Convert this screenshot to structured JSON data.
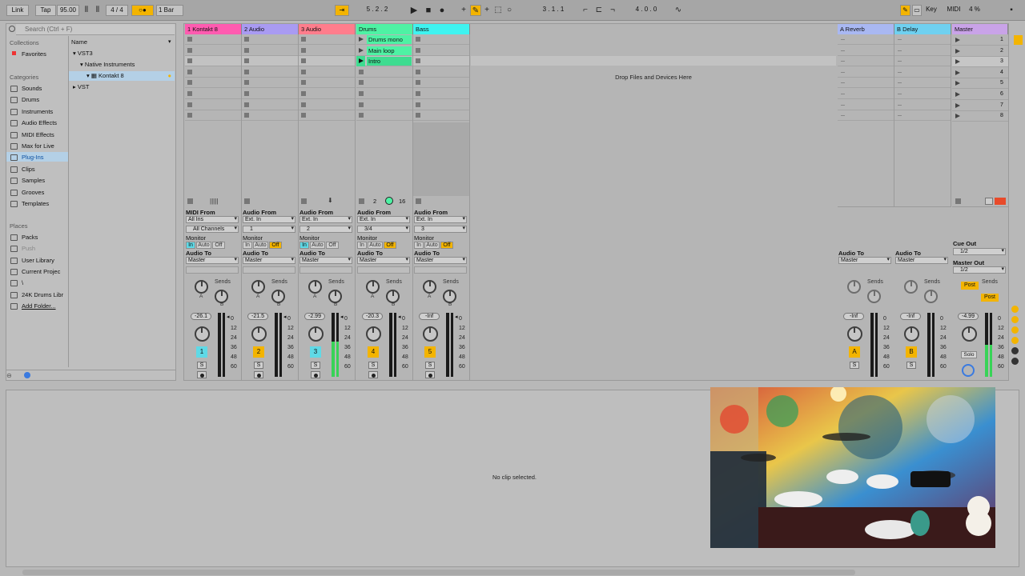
{
  "transport": {
    "link": "Link",
    "tap": "Tap",
    "tempo": "95.00",
    "signature": "4 / 4",
    "quantize": "1 Bar",
    "position": "5 .  2 .  2",
    "loop_start": "3 .  1 .  1",
    "loop_length": "4 .  0 .  0",
    "key": "Key",
    "midi": "MIDI",
    "cpu": "4 %"
  },
  "browser": {
    "search_placeholder": "Search (Ctrl + F)",
    "collections_header": "Collections",
    "favorites": "Favorites",
    "categories_header": "Categories",
    "categories": [
      "Sounds",
      "Drums",
      "Instruments",
      "Audio Effects",
      "MIDI Effects",
      "Max for Live",
      "Plug-Ins",
      "Clips",
      "Samples",
      "Grooves",
      "Templates"
    ],
    "places_header": "Places",
    "places": [
      "Packs",
      "Push",
      "User Library",
      "Current Projec",
      "\\",
      "24K Drums Libr",
      "Add Folder..."
    ],
    "name_header": "Name",
    "tree": {
      "vst3": "VST3",
      "native": "Native Instruments",
      "kontakt": "Kontakt 8",
      "vst": "VST"
    }
  },
  "tracks": [
    {
      "name": "1 Kontakt 8",
      "color": "#ff5bb0",
      "io_from": "MIDI From",
      "from": "All Ins",
      "channel": "All Channels",
      "vol": "-26.1",
      "num": "1",
      "numcolor": "#5fd9e6"
    },
    {
      "name": "2 Audio",
      "color": "#a99bf2",
      "io_from": "Audio From",
      "from": "Ext. In",
      "channel": "1",
      "vol": "-21.5",
      "num": "2",
      "numcolor": "#f3b400"
    },
    {
      "name": "3 Audio",
      "color": "#ff7d8c",
      "io_from": "Audio From",
      "from": "Ext. In",
      "channel": "2",
      "vol": "-2.99",
      "num": "3",
      "numcolor": "#5fd9e6"
    },
    {
      "name": "Drums",
      "color": "#4ef2a4",
      "io_from": "Audio From",
      "from": "Ext. In",
      "channel": "3/4",
      "vol": "-20.3",
      "num": "4",
      "numcolor": "#f3b400"
    },
    {
      "name": "Bass",
      "color": "#3ff3f0",
      "io_from": "Audio From",
      "from": "Ext. In",
      "channel": "3",
      "vol": "-Inf",
      "num": "5",
      "numcolor": "#f3b400"
    }
  ],
  "clips": [
    "Drums mono",
    "Main loop",
    "Intro"
  ],
  "common": {
    "monitor": "Monitor",
    "in": "In",
    "auto": "Auto",
    "off": "Off",
    "audio_to": "Audio To",
    "master": "Master",
    "sends": "Sends",
    "a": "A",
    "b": "B",
    "s": "S",
    "solo": "Solo",
    "post": "Post",
    "cue_out": "Cue Out",
    "master_out": "Master Out",
    "half": "1/2",
    "drop": "Drop Files and Devices Here",
    "no_clip": "No clip selected.",
    "drum_seq_a": "2",
    "drum_seq_b": "16"
  },
  "returns": [
    {
      "name": "A Reverb",
      "color": "#a9b8f2",
      "vol": "-Inf",
      "letter": "A"
    },
    {
      "name": "B Delay",
      "color": "#6fd0f0",
      "vol": "-Inf",
      "letter": "B"
    }
  ],
  "master": {
    "name": "Master",
    "color": "#c9a3e8",
    "vol": "-4.99"
  },
  "scenes": [
    "1",
    "2",
    "3",
    "4",
    "5",
    "6",
    "7",
    "8"
  ],
  "meter_scale": [
    "0",
    "12",
    "24",
    "36",
    "48",
    "60"
  ]
}
